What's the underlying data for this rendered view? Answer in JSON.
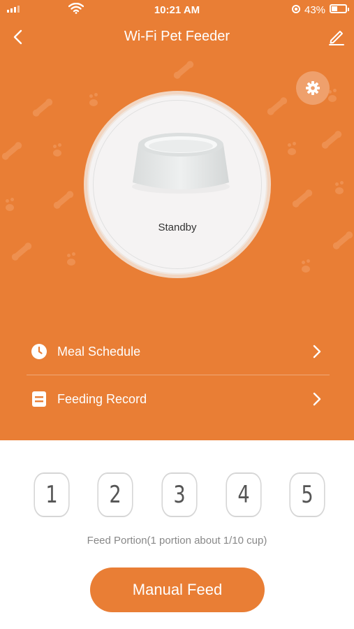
{
  "status_bar": {
    "time": "10:21 AM",
    "battery_percent": "43%"
  },
  "header": {
    "title": "Wi-Fi Pet Feeder",
    "back_icon": "chevron-left-icon",
    "edit_icon": "pencil-icon"
  },
  "device": {
    "state": "Standby",
    "settings_icon": "gear-icon"
  },
  "menu": [
    {
      "label": "Meal Schedule",
      "icon": "clock-icon"
    },
    {
      "label": "Feeding Record",
      "icon": "list-icon"
    }
  ],
  "portions": {
    "options": [
      "1",
      "2",
      "3",
      "4",
      "5"
    ],
    "caption": "Feed Portion(1 portion about 1/10 cup)"
  },
  "manual_feed_label": "Manual Feed",
  "colors": {
    "accent": "#E97E35",
    "background": "#FFFFFF"
  }
}
